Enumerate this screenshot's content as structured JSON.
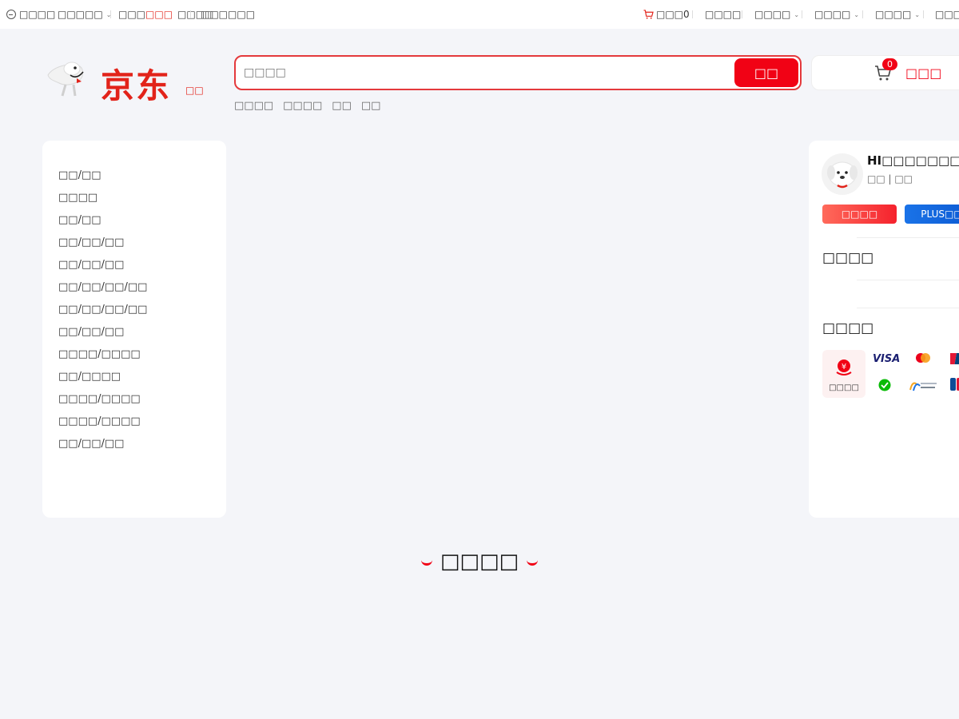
{
  "topbar": {
    "home": "□□□□",
    "location": "□□□□□",
    "promo_pre": "□□□",
    "promo_hl": "□□□",
    "promo_post": "□□□□",
    "account": "□□□□□□",
    "cart": "□□□0",
    "orders": "□□□□",
    "menu1": "□□□□",
    "menu2": "□□□□",
    "menu3": "□□□□",
    "menu4": "□□□□"
  },
  "header": {
    "logo_text": "京东",
    "logo_sub": "□□",
    "search_placeholder": "□□□□",
    "search_button": "□□",
    "hotwords": [
      "□□□□",
      "□□□□",
      "□□",
      "□□"
    ],
    "cart_count": "0",
    "cart_label": "□□□"
  },
  "categories": [
    "□□/□□",
    "□□□□",
    "□□/□□",
    "□□/□□/□□",
    "□□/□□/□□",
    "□□/□□/□□/□□",
    "□□/□□/□□/□□",
    "□□/□□/□□",
    "□□□□/□□□□",
    "□□/□□□□",
    "□□□□/□□□□",
    "□□□□/□□□□",
    "□□/□□/□□"
  ],
  "user_panel": {
    "greeting": "HI□□□□□□□!",
    "login_links": "□□ | □□",
    "register_button": "□□□□",
    "plus_button": "PLUS□□",
    "section1": "□□□□",
    "section2": "□□□□",
    "pay_main": "□□□□",
    "pay_visa": "VISA"
  },
  "section": {
    "title": "□□□□"
  },
  "colors": {
    "brand_red": "#f10215",
    "plus_blue": "#0b57d0"
  }
}
